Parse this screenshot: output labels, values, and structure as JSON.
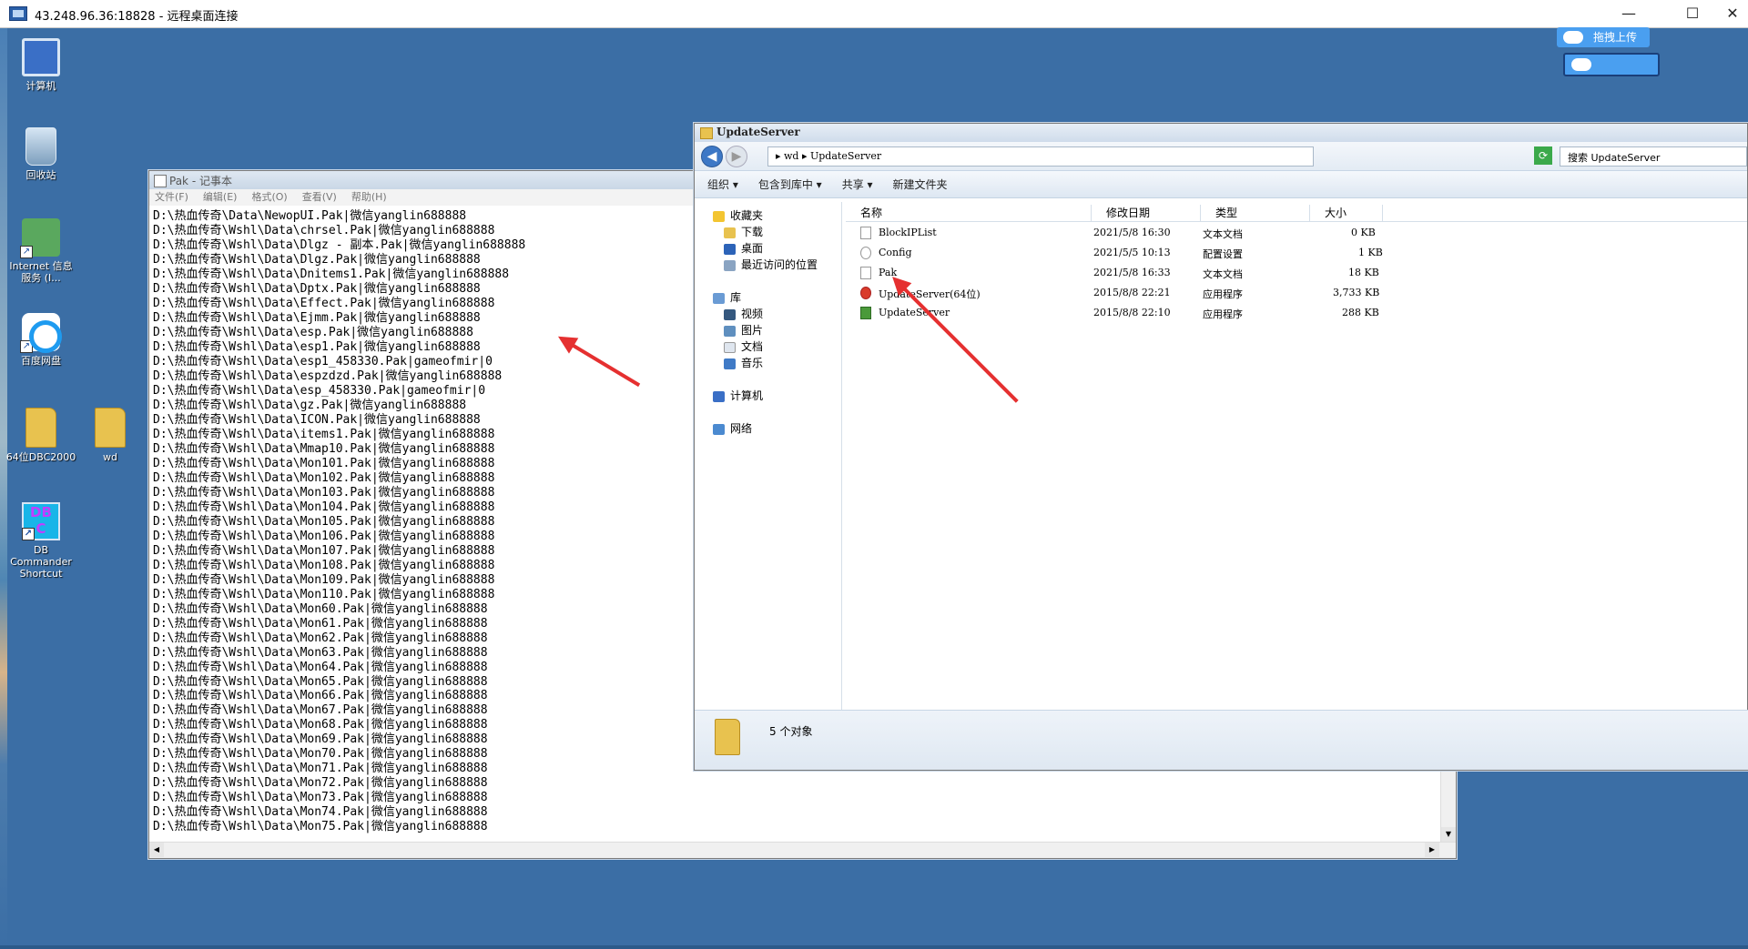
{
  "rdp": {
    "title": "43.248.96.36:18828 - 远程桌面连接",
    "minimize": "—",
    "maximize": "☐",
    "close": "✕"
  },
  "desktop_icons": [
    {
      "label": "计算机",
      "icon": "computer-icon"
    },
    {
      "label": "回收站",
      "icon": "recycle-bin-icon"
    },
    {
      "label": "Internet 信息服务 (I...",
      "icon": "iis-icon"
    },
    {
      "label": "百度网盘",
      "icon": "baidu-netdisk-icon"
    },
    {
      "label": "64位DBC2000",
      "icon": "folder-icon"
    },
    {
      "label": "wd",
      "icon": "folder-icon"
    },
    {
      "label": "DB Commander Shortcut",
      "icon": "db-commander-icon"
    }
  ],
  "baidu_upload": {
    "label": "拖拽上传"
  },
  "notepad": {
    "title": "Pak - 记事本",
    "menu": [
      "文件(F)",
      "编辑(E)",
      "格式(O)",
      "查看(V)",
      "帮助(H)"
    ],
    "lines": [
      "D:\\热血传奇\\Data\\NewopUI.Pak|微信yanglin688888",
      "D:\\热血传奇\\Wshl\\Data\\chrsel.Pak|微信yanglin688888",
      "D:\\热血传奇\\Wshl\\Data\\Dlgz - 副本.Pak|微信yanglin688888",
      "D:\\热血传奇\\Wshl\\Data\\Dlgz.Pak|微信yanglin688888",
      "D:\\热血传奇\\Wshl\\Data\\Dnitems1.Pak|微信yanglin688888",
      "D:\\热血传奇\\Wshl\\Data\\Dptx.Pak|微信yanglin688888",
      "D:\\热血传奇\\Wshl\\Data\\Effect.Pak|微信yanglin688888",
      "D:\\热血传奇\\Wshl\\Data\\Ejmm.Pak|微信yanglin688888",
      "D:\\热血传奇\\Wshl\\Data\\esp.Pak|微信yanglin688888",
      "D:\\热血传奇\\Wshl\\Data\\esp1.Pak|微信yanglin688888",
      "D:\\热血传奇\\Wshl\\Data\\esp1_458330.Pak|gameofmir|0",
      "D:\\热血传奇\\Wshl\\Data\\espzdzd.Pak|微信yanglin688888",
      "D:\\热血传奇\\Wshl\\Data\\esp_458330.Pak|gameofmir|0",
      "D:\\热血传奇\\Wshl\\Data\\gz.Pak|微信yanglin688888",
      "D:\\热血传奇\\Wshl\\Data\\ICON.Pak|微信yanglin688888",
      "D:\\热血传奇\\Wshl\\Data\\items1.Pak|微信yanglin688888",
      "D:\\热血传奇\\Wshl\\Data\\Mmap10.Pak|微信yanglin688888",
      "D:\\热血传奇\\Wshl\\Data\\Mon101.Pak|微信yanglin688888",
      "D:\\热血传奇\\Wshl\\Data\\Mon102.Pak|微信yanglin688888",
      "D:\\热血传奇\\Wshl\\Data\\Mon103.Pak|微信yanglin688888",
      "D:\\热血传奇\\Wshl\\Data\\Mon104.Pak|微信yanglin688888",
      "D:\\热血传奇\\Wshl\\Data\\Mon105.Pak|微信yanglin688888",
      "D:\\热血传奇\\Wshl\\Data\\Mon106.Pak|微信yanglin688888",
      "D:\\热血传奇\\Wshl\\Data\\Mon107.Pak|微信yanglin688888",
      "D:\\热血传奇\\Wshl\\Data\\Mon108.Pak|微信yanglin688888",
      "D:\\热血传奇\\Wshl\\Data\\Mon109.Pak|微信yanglin688888",
      "D:\\热血传奇\\Wshl\\Data\\Mon110.Pak|微信yanglin688888",
      "D:\\热血传奇\\Wshl\\Data\\Mon60.Pak|微信yanglin688888",
      "D:\\热血传奇\\Wshl\\Data\\Mon61.Pak|微信yanglin688888",
      "D:\\热血传奇\\Wshl\\Data\\Mon62.Pak|微信yanglin688888",
      "D:\\热血传奇\\Wshl\\Data\\Mon63.Pak|微信yanglin688888",
      "D:\\热血传奇\\Wshl\\Data\\Mon64.Pak|微信yanglin688888",
      "D:\\热血传奇\\Wshl\\Data\\Mon65.Pak|微信yanglin688888",
      "D:\\热血传奇\\Wshl\\Data\\Mon66.Pak|微信yanglin688888",
      "D:\\热血传奇\\Wshl\\Data\\Mon67.Pak|微信yanglin688888",
      "D:\\热血传奇\\Wshl\\Data\\Mon68.Pak|微信yanglin688888",
      "D:\\热血传奇\\Wshl\\Data\\Mon69.Pak|微信yanglin688888",
      "D:\\热血传奇\\Wshl\\Data\\Mon70.Pak|微信yanglin688888",
      "D:\\热血传奇\\Wshl\\Data\\Mon71.Pak|微信yanglin688888",
      "D:\\热血传奇\\Wshl\\Data\\Mon72.Pak|微信yanglin688888",
      "D:\\热血传奇\\Wshl\\Data\\Mon73.Pak|微信yanglin688888",
      "D:\\热血传奇\\Wshl\\Data\\Mon74.Pak|微信yanglin688888",
      "D:\\热血传奇\\Wshl\\Data\\Mon75.Pak|微信yanglin688888"
    ]
  },
  "explorer": {
    "title": "UpdateServer",
    "path": "▸ wd ▸ UpdateServer",
    "search_placeholder": "搜索 UpdateServer",
    "commands": [
      "组织 ▾",
      "包含到库中 ▾",
      "共享 ▾",
      "新建文件夹"
    ],
    "nav": [
      {
        "label": "收藏夹",
        "icon": "star-icon",
        "indent": 0
      },
      {
        "label": "下载",
        "icon": "download-folder-icon",
        "indent": 1
      },
      {
        "label": "桌面",
        "icon": "desktop-icon",
        "indent": 1
      },
      {
        "label": "最近访问的位置",
        "icon": "recent-places-icon",
        "indent": 1
      },
      {
        "label": "库",
        "icon": "library-icon",
        "indent": 0
      },
      {
        "label": "视频",
        "icon": "video-icon",
        "indent": 1
      },
      {
        "label": "图片",
        "icon": "picture-icon",
        "indent": 1
      },
      {
        "label": "文档",
        "icon": "document-icon",
        "indent": 1
      },
      {
        "label": "音乐",
        "icon": "music-icon",
        "indent": 1
      },
      {
        "label": "计算机",
        "icon": "computer-icon",
        "indent": 0
      },
      {
        "label": "网络",
        "icon": "network-icon",
        "indent": 0
      }
    ],
    "columns": [
      "名称",
      "修改日期",
      "类型",
      "大小"
    ],
    "files": [
      {
        "name": "BlockIPList",
        "date": "2021/5/8 16:30",
        "type": "文本文档",
        "size": "0 KB",
        "icon": "text-file-icon"
      },
      {
        "name": "Config",
        "date": "2021/5/5 10:13",
        "type": "配置设置",
        "size": "1 KB",
        "icon": "config-file-icon"
      },
      {
        "name": "Pak",
        "date": "2021/5/8 16:33",
        "type": "文本文档",
        "size": "18 KB",
        "icon": "text-file-icon"
      },
      {
        "name": "UpdateServer(64位)",
        "date": "2015/8/8 22:21",
        "type": "应用程序",
        "size": "3,733 KB",
        "icon": "app-icon"
      },
      {
        "name": "UpdateServer",
        "date": "2015/8/8 22:10",
        "type": "应用程序",
        "size": "288 KB",
        "icon": "app-icon"
      }
    ],
    "status": "5 个对象"
  }
}
